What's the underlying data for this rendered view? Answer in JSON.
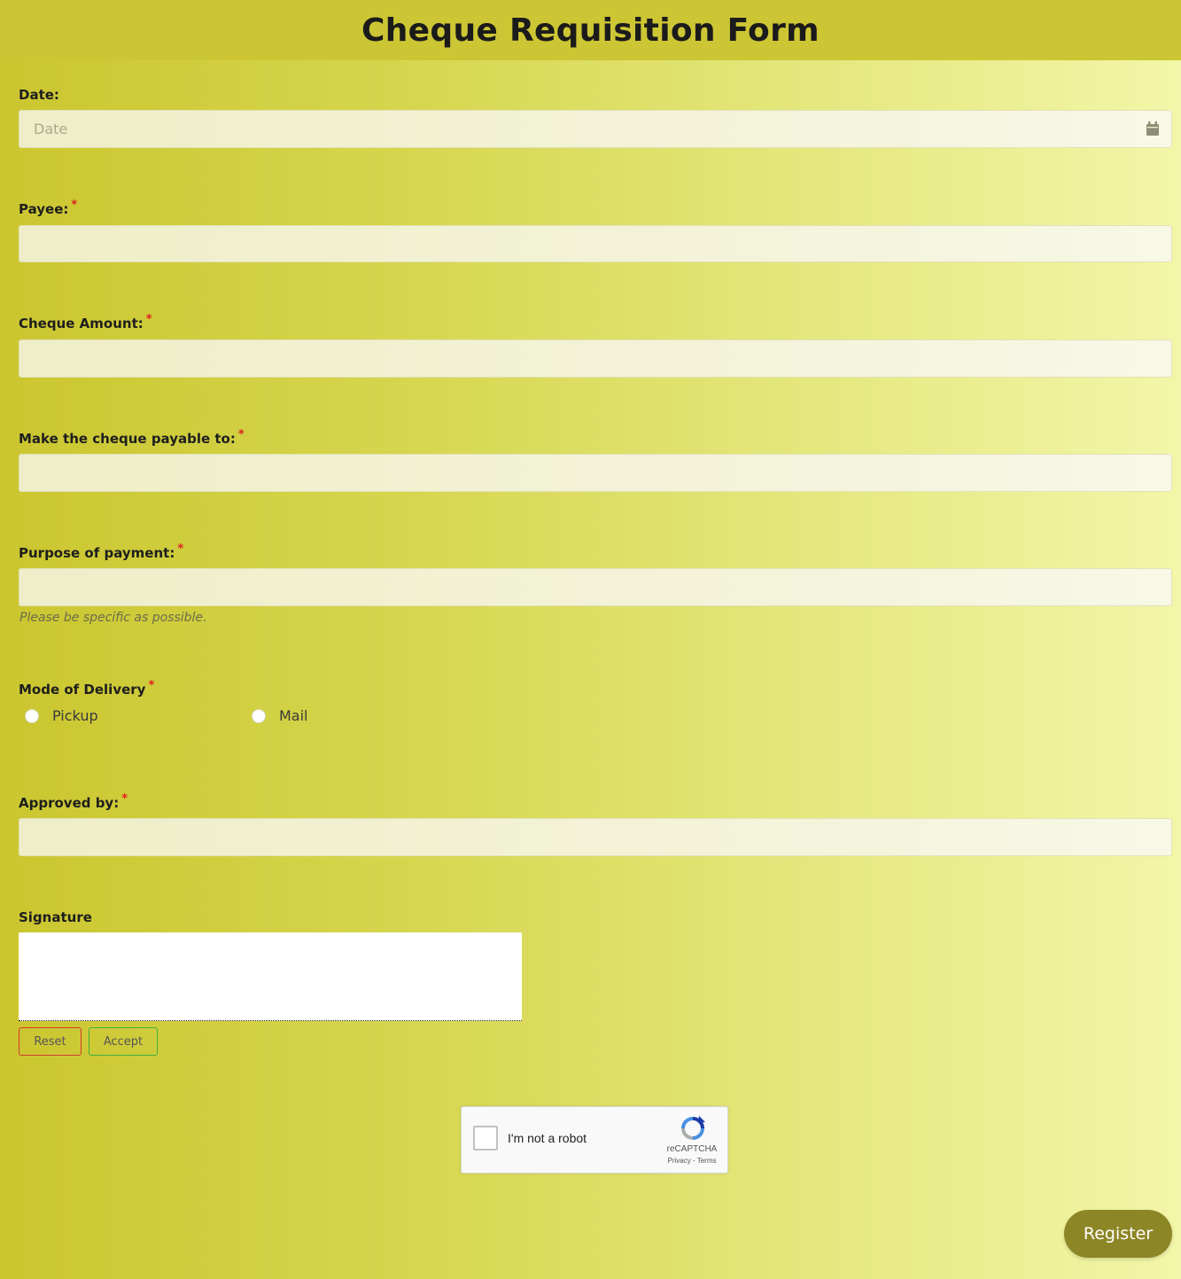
{
  "form": {
    "title": "Cheque Requisition Form"
  },
  "fields": {
    "date": {
      "label": "Date:",
      "placeholder": "Date",
      "value": ""
    },
    "payee": {
      "label": "Payee:",
      "required": "*",
      "value": ""
    },
    "cheque_amount": {
      "label": "Cheque Amount:",
      "required": "*",
      "value": ""
    },
    "payable_to": {
      "label": "Make the cheque payable to:",
      "required": "*",
      "value": ""
    },
    "purpose": {
      "label": "Purpose of payment:",
      "required": "*",
      "value": "",
      "help": "Please be specific as possible."
    },
    "delivery": {
      "label": "Mode of Delivery",
      "required": "*",
      "options": [
        "Pickup",
        "Mail"
      ]
    },
    "approved_by": {
      "label": "Approved by:",
      "required": "*",
      "value": ""
    },
    "signature": {
      "label": "Signature",
      "reset_label": "Reset",
      "accept_label": "Accept"
    }
  },
  "captcha": {
    "text": "I'm not a robot",
    "brand": "reCAPTCHA",
    "links": "Privacy - Terms"
  },
  "actions": {
    "register_label": "Register"
  },
  "icons": {
    "date": "calendar-icon",
    "captcha": "recaptcha-logo-icon"
  },
  "colors": {
    "header_bg": "#cdc634",
    "register_bg": "#8d8626",
    "required": "#e02020",
    "reset_border": "#d23b2b",
    "accept_border": "#3fae3f"
  }
}
